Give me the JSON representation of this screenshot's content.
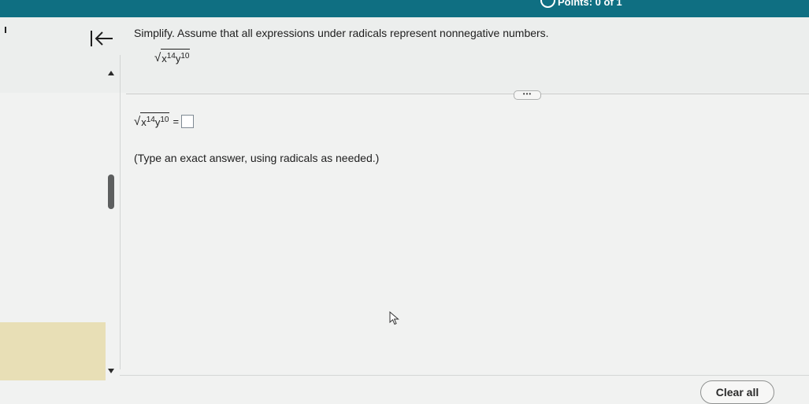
{
  "header": {
    "points_label": "Points: 0 of 1"
  },
  "question": {
    "instruction": "Simplify. Assume that all expressions under radicals represent nonnegative numbers.",
    "expression": {
      "base1": "x",
      "exp1": "14",
      "base2": "y",
      "exp2": "10"
    },
    "answer_prefix": {
      "base1": "x",
      "exp1": "14",
      "base2": "y",
      "exp2": "10",
      "equals": "="
    },
    "hint": "(Type an exact answer, using radicals as needed.)",
    "more_label": "•••"
  },
  "footer": {
    "clear_all_label": "Clear all"
  },
  "icons": {
    "back_first": "back-to-first-icon",
    "points_status": "circle-status-icon",
    "scroll_up": "triangle-up-icon",
    "scroll_down": "triangle-down-icon",
    "cursor": "mouse-pointer-icon"
  },
  "colors": {
    "topbar": "#0f6f82",
    "nav_highlight": "#e8dfb6"
  }
}
